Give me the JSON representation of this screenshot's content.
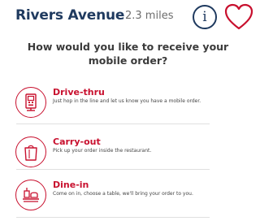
{
  "header": {
    "store_name": "Rivers Avenue",
    "distance": "2.3 miles",
    "info_icon": "info-icon",
    "favorite_icon": "heart-icon"
  },
  "prompt": {
    "line1": "How would you like to receive your",
    "line2": "mobile order?"
  },
  "options": [
    {
      "title": "Drive-thru",
      "description": "Just hop in the line and let us know you have a mobile order.",
      "icon": "drive-thru-icon"
    },
    {
      "title": "Carry-out",
      "description": "Pick up your order inside the restaurant.",
      "icon": "carry-out-bag-icon"
    },
    {
      "title": "Dine-in",
      "description": "Come on in, choose a table, we'll bring your order to you.",
      "icon": "dine-in-tray-icon"
    }
  ],
  "colors": {
    "brand_red": "#c8102e",
    "navy": "#1f3a5f"
  }
}
